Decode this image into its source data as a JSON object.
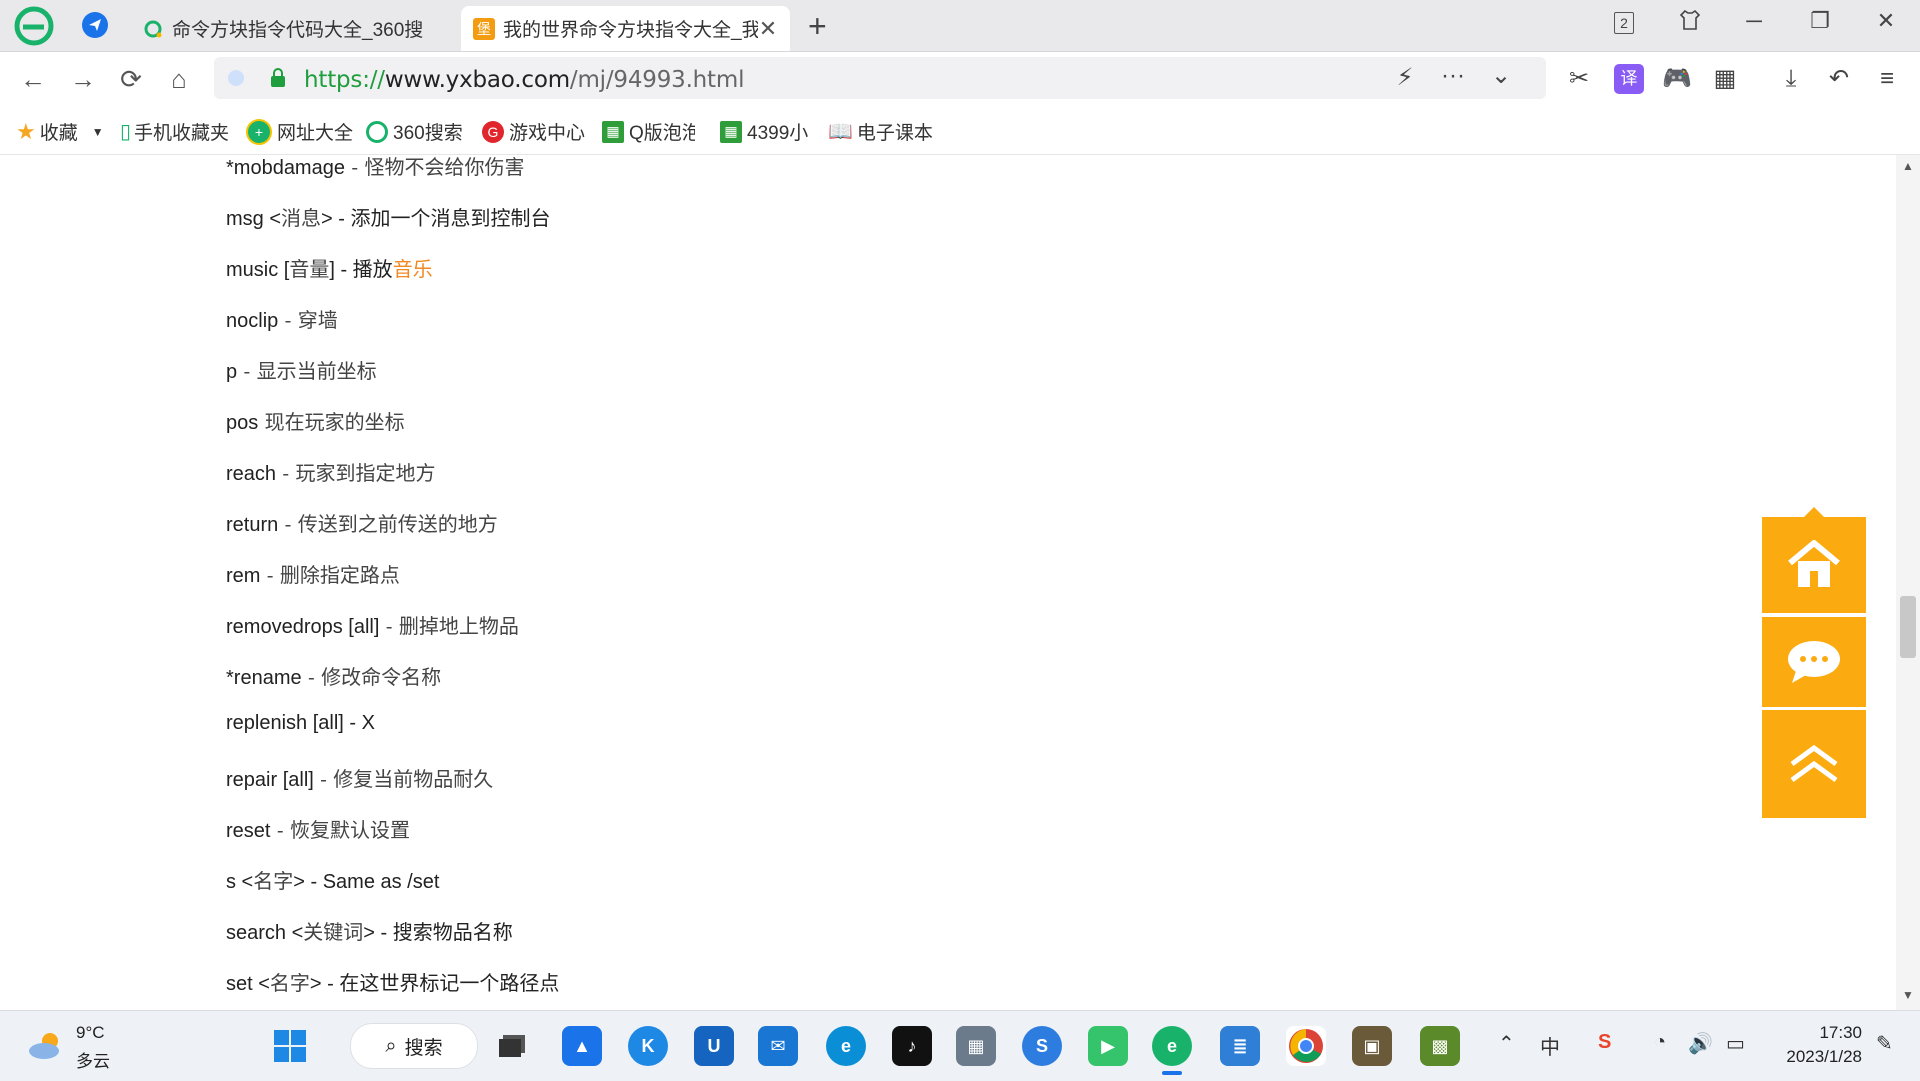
{
  "browser": {
    "tabs": [
      {
        "title": "命令方块指令代码大全_360搜",
        "active": false
      },
      {
        "title": "我的世界命令方块指令大全_我",
        "active": true
      }
    ],
    "tab_count_badge": "2",
    "address": {
      "scheme": "https://",
      "host": "www.yxbao.com",
      "path": "/mj/94993.html"
    }
  },
  "bookmarks": [
    {
      "label": "收藏",
      "icon": "star-icon"
    },
    {
      "label": "手机收藏夹",
      "icon": "phone-icon"
    },
    {
      "label": "网址大全",
      "icon": "plus-globe-icon"
    },
    {
      "label": "360搜索",
      "icon": "search-360-icon"
    },
    {
      "label": "游戏中心",
      "icon": "game-center-icon"
    },
    {
      "label": "Q版泡泡",
      "icon": "grid-game-icon"
    },
    {
      "label": "4399小",
      "icon": "grid-game-icon"
    },
    {
      "label": "电子课本",
      "icon": "book-icon"
    }
  ],
  "content": {
    "commands": [
      {
        "name": "*mobdamage",
        "desc": " - 怪物不会给你伤害"
      },
      {
        "name": "msg <",
        "desc": "消息",
        "tail": "> - 添加一个消息到控制台"
      },
      {
        "name": "music [",
        "desc": "音量",
        "tail": "] - 播放",
        "link": "音乐"
      },
      {
        "name": "noclip",
        "desc": " - 穿墙"
      },
      {
        "name": "p",
        "desc": " - 显示当前坐标"
      },
      {
        "name": "pos",
        "desc": " 现在玩家的坐标"
      },
      {
        "name": "reach",
        "desc": " - 玩家到指定地方"
      },
      {
        "name": "return",
        "desc": " - 传送到之前传送的地方"
      },
      {
        "name": "rem",
        "desc": " - 删除指定路点"
      },
      {
        "name": "removedrops [all]",
        "desc": " - 删掉地上物品"
      },
      {
        "name": "*rename",
        "desc": " - 修改命令名称"
      },
      {
        "name": "replenish [all] - X",
        "desc": ""
      },
      {
        "name": "repair [all]",
        "desc": " - 修复当前物品耐久"
      },
      {
        "name": "reset",
        "desc": " - 恢复默认设置"
      },
      {
        "name": "s <",
        "desc": "名字",
        "tail": "> - Same as /set"
      },
      {
        "name": "search <",
        "desc": "关键词",
        "tail": "> - 搜索物品名称"
      },
      {
        "name": "set <",
        "desc": "名字",
        "tail": "> - 在这世界标记一个路径点"
      }
    ]
  },
  "taskbar": {
    "weather_temp": "9°C",
    "weather_desc": "多云",
    "search_label": "搜索",
    "ime": "中",
    "time": "17:30",
    "date": "2023/1/28"
  },
  "colors": {
    "accent_orange": "#fbaa10",
    "link_orange": "#f08a24",
    "url_green": "#1e9e3c"
  }
}
